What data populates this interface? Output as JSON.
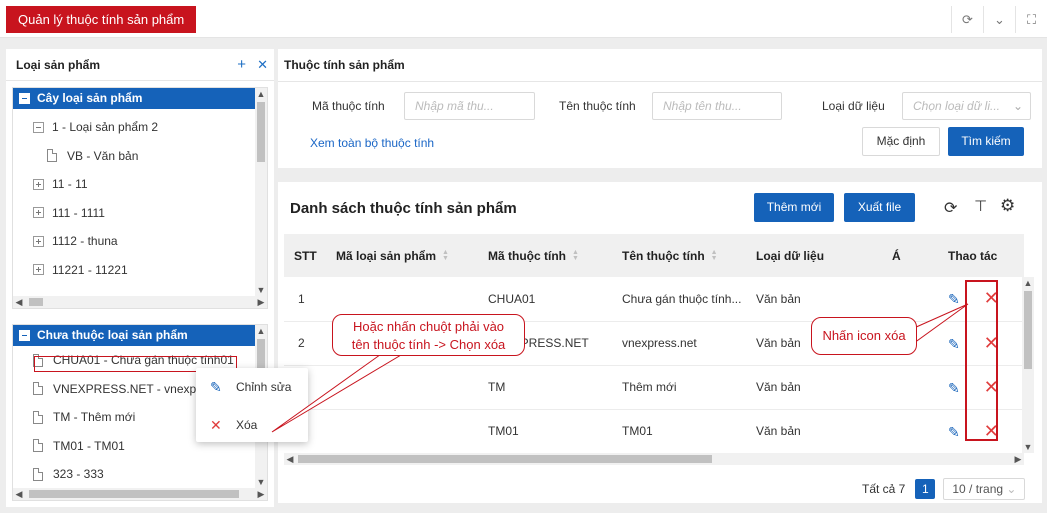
{
  "top": {
    "tab": "Quản lý thuộc tính sản phẩm"
  },
  "left": {
    "title": "Loại sản phẩm",
    "add": "+",
    "close": "✕",
    "tree_title": "Cây loại sản phẩm",
    "tree_items": [
      {
        "label": "1 - Loại sản phẩm 2",
        "kind": "minus"
      },
      {
        "label": "VB - Văn bản",
        "kind": "doc"
      },
      {
        "label": "11 - 11",
        "kind": "plus"
      },
      {
        "label": "111 - 1111",
        "kind": "plus"
      },
      {
        "label": "1112 - thuna",
        "kind": "plus"
      },
      {
        "label": "11221 - 11221",
        "kind": "plus"
      }
    ],
    "unassigned_title": "Chưa thuộc loại sản phẩm",
    "unassigned_items": [
      "CHUA01 - Chưa gán thuộc tính01",
      "VNEXPRESS.NET - vnexpress.net",
      "TM - Thêm mới",
      "TM01 - TM01",
      "323 - 333"
    ]
  },
  "filter": {
    "title": "Thuộc tính sản phẩm",
    "code_label": "Mã thuộc tính",
    "code_placeholder": "Nhập mã thu...",
    "name_label": "Tên thuộc tính",
    "name_placeholder": "Nhập tên thu...",
    "type_label": "Loại dữ liệu",
    "type_placeholder": "Chọn loại dữ li...",
    "view_all": "Xem toàn bộ thuộc tính",
    "default_btn": "Mặc định",
    "search_btn": "Tìm kiếm"
  },
  "list": {
    "title": "Danh sách thuộc tính sản phẩm",
    "add_btn": "Thêm mới",
    "export_btn": "Xuất file",
    "columns": [
      "STT",
      "Mã loại sản phẩm",
      "Mã thuộc tính",
      "Tên thuộc tính",
      "Loại dữ liệu",
      "Á",
      "Thao tác"
    ],
    "rows": [
      {
        "stt": "1",
        "category": "",
        "code": "CHUA01",
        "name": "Chưa gán thuộc tính...",
        "type": "Văn bản"
      },
      {
        "stt": "2",
        "category": "",
        "code": "VNEXPRESS.NET",
        "name": "vnexpress.net",
        "type": "Văn bản"
      },
      {
        "stt": "",
        "category": "",
        "code": "TM",
        "name": "Thêm mới",
        "type": "Văn bản"
      },
      {
        "stt": "",
        "category": "",
        "code": "TM01",
        "name": "TM01",
        "type": "Văn bản"
      }
    ],
    "total": "Tất cả 7",
    "page": "1",
    "page_size": "10 / trang"
  },
  "context_menu": {
    "edit": "Chỉnh sửa",
    "delete": "Xóa"
  },
  "annotations": {
    "right_click": "Hoặc nhấn chuột phải vào tên thuộc tính -> Chọn xóa",
    "delete_icon": "Nhấn icon xóa"
  },
  "colors": {
    "accent": "#1562b9",
    "brand_red": "#c8141e"
  }
}
